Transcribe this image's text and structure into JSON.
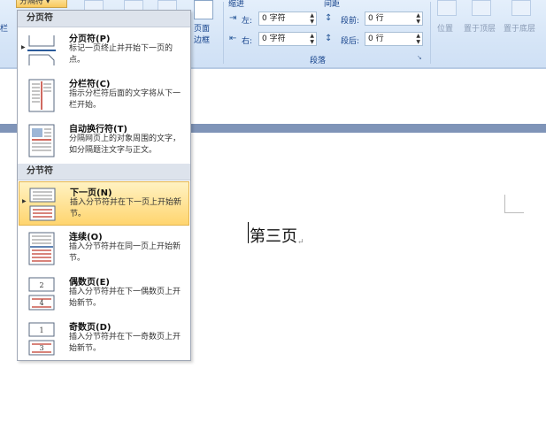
{
  "ribbon": {
    "left_partial": "栏",
    "active_button_label": "分隔符 ▾",
    "page_border_label_1": "页面",
    "page_border_label_2": "边框",
    "indent_title": "缩进",
    "indent_left_label": "左:",
    "indent_left_value": "0 字符",
    "indent_right_label": "右:",
    "indent_right_value": "0 字符",
    "spacing_title": "间距",
    "spacing_before_label": "段前:",
    "spacing_before_value": "0 行",
    "spacing_after_label": "段后:",
    "spacing_after_value": "0 行",
    "paragraph_group_label": "段落",
    "arrange_position": "位置",
    "arrange_bring_front": "置于顶层",
    "arrange_send_back": "置于底层"
  },
  "menu": {
    "section_page_breaks": "分页符",
    "section_section_breaks": "分节符",
    "items": [
      {
        "title": "分页符(P)",
        "desc": "标记一页终止并开始下一页的点。",
        "icon": "page-break-icon",
        "active": false
      },
      {
        "title": "分栏符(C)",
        "desc": "指示分栏符后面的文字将从下一栏开始。",
        "icon": "column-break-icon",
        "active": false
      },
      {
        "title": "自动换行符(T)",
        "desc": "分隔网页上的对象周围的文字，如分隔题注文字与正文。",
        "icon": "text-wrapping-break-icon",
        "active": false
      },
      {
        "title": "下一页(N)",
        "desc": "插入分节符并在下一页上开始新节。",
        "icon": "next-page-section-icon",
        "active": true
      },
      {
        "title": "连续(O)",
        "desc": "插入分节符并在同一页上开始新节。",
        "icon": "continuous-section-icon",
        "active": false
      },
      {
        "title": "偶数页(E)",
        "desc": "插入分节符并在下一偶数页上开始新节。",
        "icon": "even-page-section-icon",
        "active": false
      },
      {
        "title": "奇数页(D)",
        "desc": "插入分节符并在下一奇数页上开始新节。",
        "icon": "odd-page-section-icon",
        "active": false
      }
    ]
  },
  "document": {
    "text": "第三页",
    "paragraph_mark": "↵"
  },
  "colors": {
    "ribbon_bg": "#d6e5f7",
    "highlight": "#ffd56f",
    "doc_band": "#7f94b8"
  }
}
